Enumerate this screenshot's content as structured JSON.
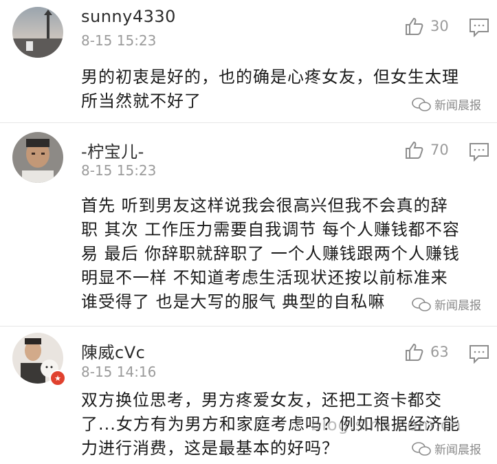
{
  "comments": [
    {
      "username": "sunny4330",
      "timestamp": "8-15 15:23",
      "likes": "30",
      "text_lines": [
        "男的初衷是好的，也的确是心疼女友，但女生太理",
        "所当然就不好了"
      ]
    },
    {
      "username": "-柠宝儿-",
      "timestamp": "8-15 15:23",
      "likes": "70",
      "text_lines": [
        "首先 听到男友这样说我会很高兴但我不会真的辞",
        "职 其次 工作压力需要自我调节 每个人赚钱都不容",
        "易 最后 你辞职就辞职了 一个人赚钱跟两个人赚钱",
        "明显不一样 不知道考虑生活现状还按以前标准来",
        "谁受得了 也是大写的服气 典型的自私嘛"
      ]
    },
    {
      "username": "陳威cVc",
      "timestamp": "8-15 14:16",
      "likes": "63",
      "text_lines": [
        "双方换位思考，男方疼爱女友，还把工资卡都交",
        "了...女方有为男方和家庭考虑吗？例如根据经济能",
        "力进行消费，这是最基本的好吗？"
      ]
    }
  ],
  "watermark": "新闻晨报",
  "overlay_watermark": "blog.sina.com.cn",
  "colors": {
    "muted": "#9a9a9a",
    "badge": "#e0412e"
  },
  "icons": {
    "like": "thumbs-up-icon",
    "reply": "comment-icon",
    "watermark": "wechat-icon"
  }
}
